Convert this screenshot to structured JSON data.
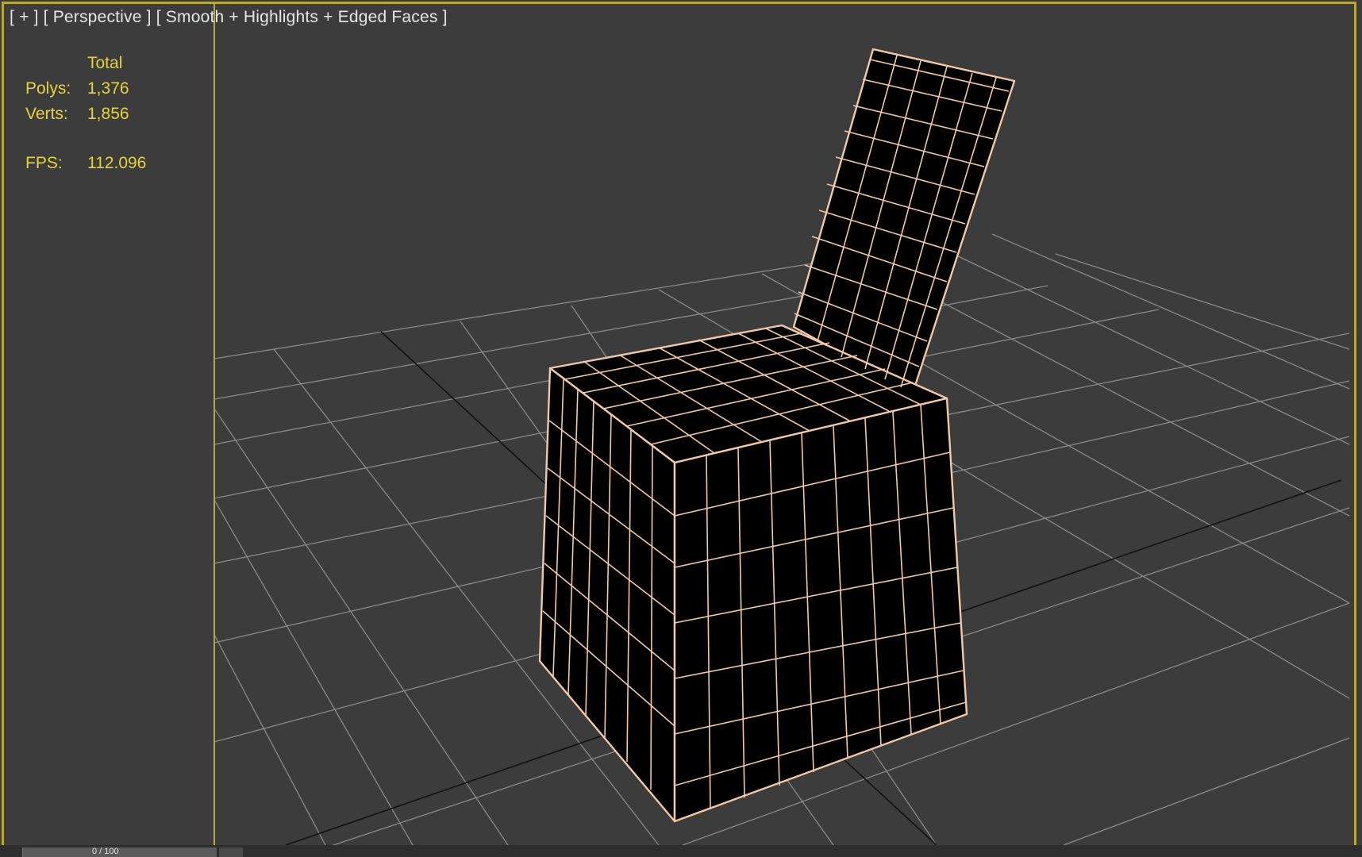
{
  "viewport": {
    "label": "[ + ] [ Perspective ] [ Smooth + Highlights + Edged Faces ]",
    "border_color": "#b8a638",
    "background": "#3c3c3c"
  },
  "stats": {
    "header": "Total",
    "polys_label": "Polys:",
    "polys_value": "1,376",
    "verts_label": "Verts:",
    "verts_value": "1,856",
    "fps_label": "FPS:",
    "fps_value": "112.096",
    "text_color": "#e6d23c"
  },
  "model": {
    "name": "chair",
    "wire_color": "#f2c8a8",
    "fill_color": "#000000"
  },
  "grid": {
    "color": "#8a8a8a",
    "axis_color": "#111111"
  },
  "timeline": {
    "frame_counter": "0 / 100"
  }
}
